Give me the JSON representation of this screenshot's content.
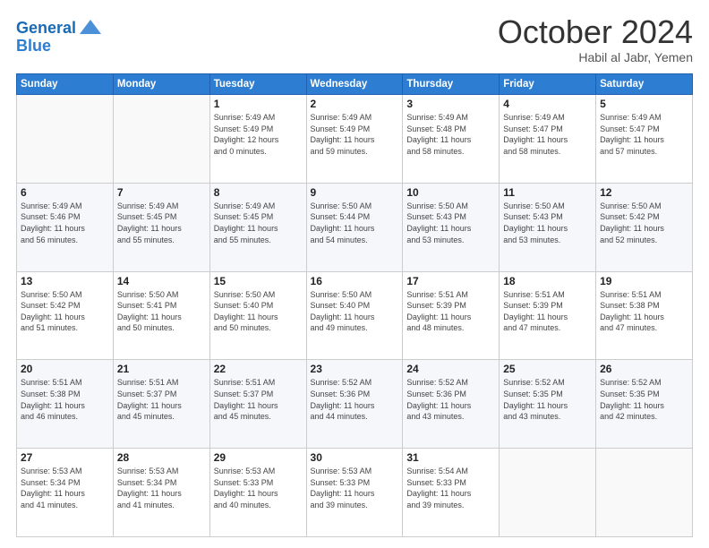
{
  "header": {
    "logo_line1": "General",
    "logo_line2": "Blue",
    "month": "October 2024",
    "location": "Habil al Jabr, Yemen"
  },
  "weekdays": [
    "Sunday",
    "Monday",
    "Tuesday",
    "Wednesday",
    "Thursday",
    "Friday",
    "Saturday"
  ],
  "weeks": [
    [
      {
        "day": "",
        "info": ""
      },
      {
        "day": "",
        "info": ""
      },
      {
        "day": "1",
        "info": "Sunrise: 5:49 AM\nSunset: 5:49 PM\nDaylight: 12 hours\nand 0 minutes."
      },
      {
        "day": "2",
        "info": "Sunrise: 5:49 AM\nSunset: 5:49 PM\nDaylight: 11 hours\nand 59 minutes."
      },
      {
        "day": "3",
        "info": "Sunrise: 5:49 AM\nSunset: 5:48 PM\nDaylight: 11 hours\nand 58 minutes."
      },
      {
        "day": "4",
        "info": "Sunrise: 5:49 AM\nSunset: 5:47 PM\nDaylight: 11 hours\nand 58 minutes."
      },
      {
        "day": "5",
        "info": "Sunrise: 5:49 AM\nSunset: 5:47 PM\nDaylight: 11 hours\nand 57 minutes."
      }
    ],
    [
      {
        "day": "6",
        "info": "Sunrise: 5:49 AM\nSunset: 5:46 PM\nDaylight: 11 hours\nand 56 minutes."
      },
      {
        "day": "7",
        "info": "Sunrise: 5:49 AM\nSunset: 5:45 PM\nDaylight: 11 hours\nand 55 minutes."
      },
      {
        "day": "8",
        "info": "Sunrise: 5:49 AM\nSunset: 5:45 PM\nDaylight: 11 hours\nand 55 minutes."
      },
      {
        "day": "9",
        "info": "Sunrise: 5:50 AM\nSunset: 5:44 PM\nDaylight: 11 hours\nand 54 minutes."
      },
      {
        "day": "10",
        "info": "Sunrise: 5:50 AM\nSunset: 5:43 PM\nDaylight: 11 hours\nand 53 minutes."
      },
      {
        "day": "11",
        "info": "Sunrise: 5:50 AM\nSunset: 5:43 PM\nDaylight: 11 hours\nand 53 minutes."
      },
      {
        "day": "12",
        "info": "Sunrise: 5:50 AM\nSunset: 5:42 PM\nDaylight: 11 hours\nand 52 minutes."
      }
    ],
    [
      {
        "day": "13",
        "info": "Sunrise: 5:50 AM\nSunset: 5:42 PM\nDaylight: 11 hours\nand 51 minutes."
      },
      {
        "day": "14",
        "info": "Sunrise: 5:50 AM\nSunset: 5:41 PM\nDaylight: 11 hours\nand 50 minutes."
      },
      {
        "day": "15",
        "info": "Sunrise: 5:50 AM\nSunset: 5:40 PM\nDaylight: 11 hours\nand 50 minutes."
      },
      {
        "day": "16",
        "info": "Sunrise: 5:50 AM\nSunset: 5:40 PM\nDaylight: 11 hours\nand 49 minutes."
      },
      {
        "day": "17",
        "info": "Sunrise: 5:51 AM\nSunset: 5:39 PM\nDaylight: 11 hours\nand 48 minutes."
      },
      {
        "day": "18",
        "info": "Sunrise: 5:51 AM\nSunset: 5:39 PM\nDaylight: 11 hours\nand 47 minutes."
      },
      {
        "day": "19",
        "info": "Sunrise: 5:51 AM\nSunset: 5:38 PM\nDaylight: 11 hours\nand 47 minutes."
      }
    ],
    [
      {
        "day": "20",
        "info": "Sunrise: 5:51 AM\nSunset: 5:38 PM\nDaylight: 11 hours\nand 46 minutes."
      },
      {
        "day": "21",
        "info": "Sunrise: 5:51 AM\nSunset: 5:37 PM\nDaylight: 11 hours\nand 45 minutes."
      },
      {
        "day": "22",
        "info": "Sunrise: 5:51 AM\nSunset: 5:37 PM\nDaylight: 11 hours\nand 45 minutes."
      },
      {
        "day": "23",
        "info": "Sunrise: 5:52 AM\nSunset: 5:36 PM\nDaylight: 11 hours\nand 44 minutes."
      },
      {
        "day": "24",
        "info": "Sunrise: 5:52 AM\nSunset: 5:36 PM\nDaylight: 11 hours\nand 43 minutes."
      },
      {
        "day": "25",
        "info": "Sunrise: 5:52 AM\nSunset: 5:35 PM\nDaylight: 11 hours\nand 43 minutes."
      },
      {
        "day": "26",
        "info": "Sunrise: 5:52 AM\nSunset: 5:35 PM\nDaylight: 11 hours\nand 42 minutes."
      }
    ],
    [
      {
        "day": "27",
        "info": "Sunrise: 5:53 AM\nSunset: 5:34 PM\nDaylight: 11 hours\nand 41 minutes."
      },
      {
        "day": "28",
        "info": "Sunrise: 5:53 AM\nSunset: 5:34 PM\nDaylight: 11 hours\nand 41 minutes."
      },
      {
        "day": "29",
        "info": "Sunrise: 5:53 AM\nSunset: 5:33 PM\nDaylight: 11 hours\nand 40 minutes."
      },
      {
        "day": "30",
        "info": "Sunrise: 5:53 AM\nSunset: 5:33 PM\nDaylight: 11 hours\nand 39 minutes."
      },
      {
        "day": "31",
        "info": "Sunrise: 5:54 AM\nSunset: 5:33 PM\nDaylight: 11 hours\nand 39 minutes."
      },
      {
        "day": "",
        "info": ""
      },
      {
        "day": "",
        "info": ""
      }
    ]
  ]
}
